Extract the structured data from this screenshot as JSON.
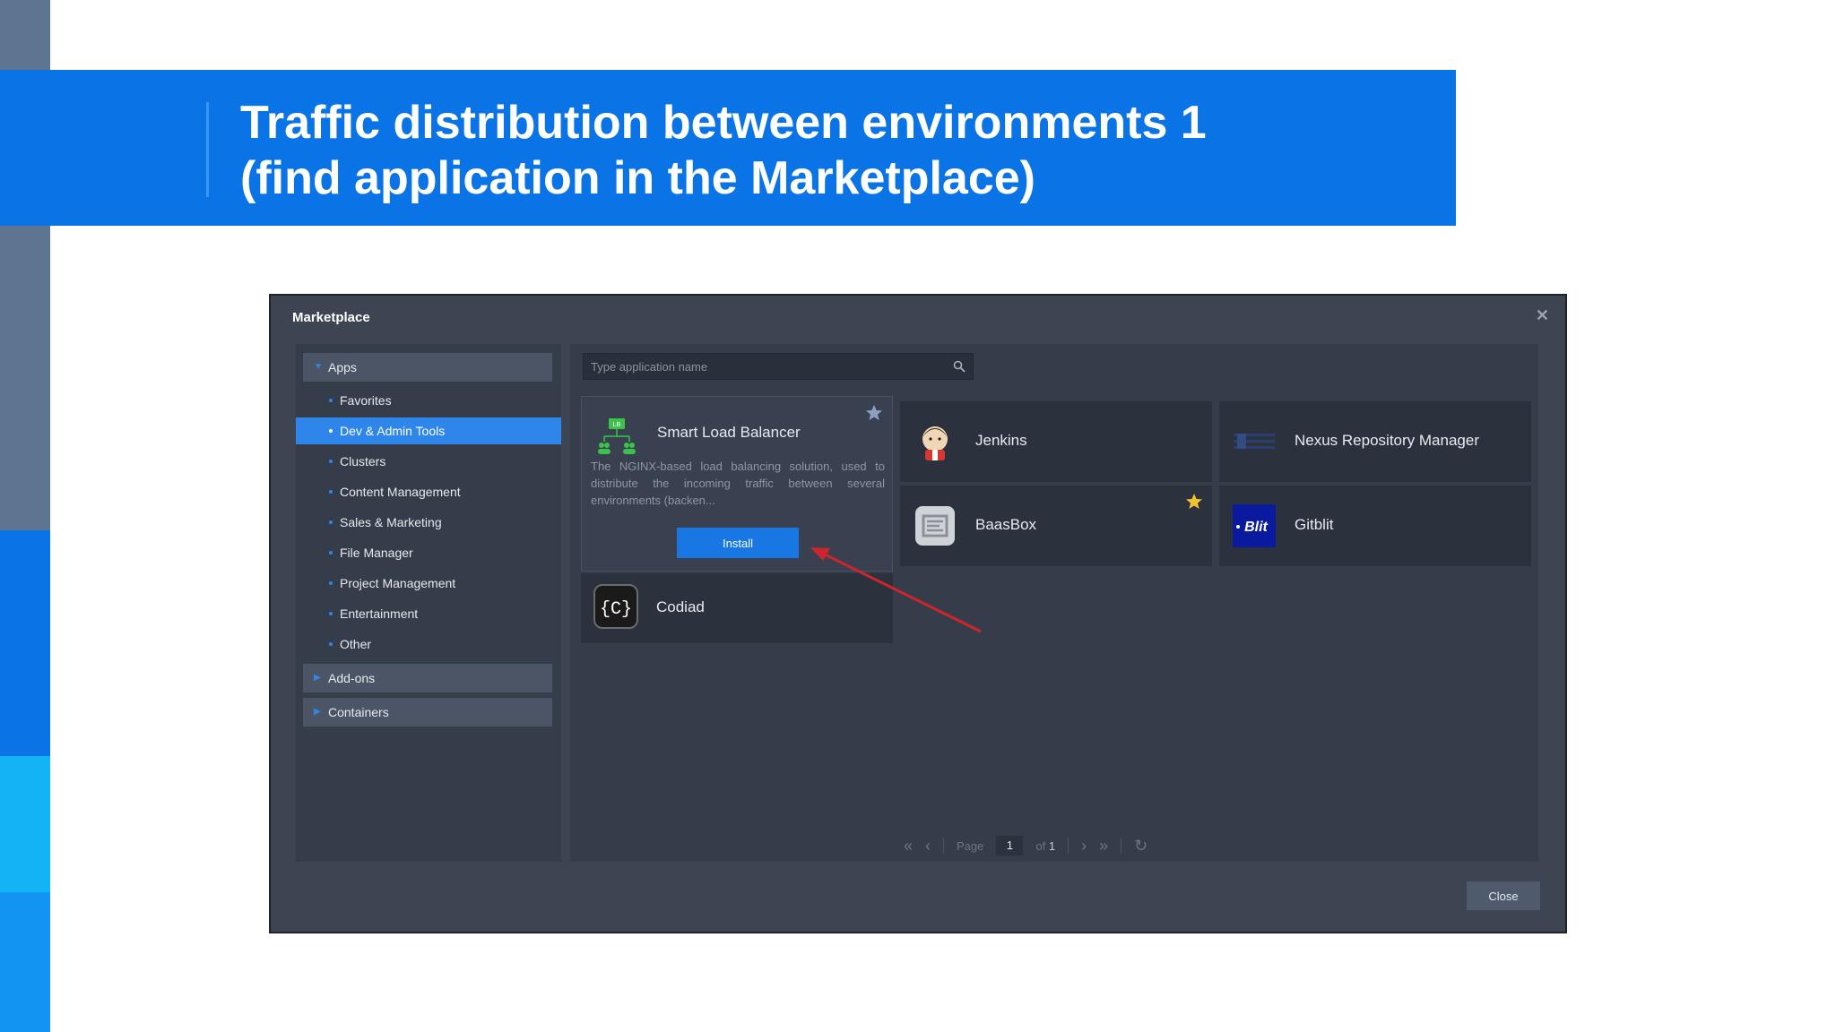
{
  "slide": {
    "title_line1": "Traffic distribution between environments 1",
    "title_line2": "(find application in the Marketplace)"
  },
  "window": {
    "title": "Marketplace",
    "close_x": "✕",
    "close_button": "Close"
  },
  "sidebar": {
    "apps_label": "Apps",
    "items": [
      {
        "label": "Favorites",
        "selected": false
      },
      {
        "label": "Dev & Admin Tools",
        "selected": true
      },
      {
        "label": "Clusters",
        "selected": false
      },
      {
        "label": "Content Management",
        "selected": false
      },
      {
        "label": "Sales & Marketing",
        "selected": false
      },
      {
        "label": "File Manager",
        "selected": false
      },
      {
        "label": "Project Management",
        "selected": false
      },
      {
        "label": "Entertainment",
        "selected": false
      },
      {
        "label": "Other",
        "selected": false
      }
    ],
    "addons_label": "Add-ons",
    "containers_label": "Containers"
  },
  "search": {
    "placeholder": "Type application name",
    "icon": "search-icon"
  },
  "apps": [
    {
      "name": "Smart Load Balancer",
      "description": "The NGINX-based load balancing solution, used to distribute the incoming traffic between several environments (backen...",
      "install_label": "Install",
      "favorite": true,
      "icon": "load-balancer-icon",
      "icon_badge": "LB"
    },
    {
      "name": "Jenkins",
      "icon": "jenkins-icon",
      "favorite": false
    },
    {
      "name": "Nexus Repository Manager",
      "icon": "nexus-icon",
      "favorite": false
    },
    {
      "name": "BaasBox",
      "icon": "baasbox-icon",
      "favorite": true
    },
    {
      "name": "Gitblit",
      "icon": "gitblit-icon",
      "icon_text": "Blit",
      "favorite": false
    },
    {
      "name": "Codiad",
      "icon": "codiad-icon",
      "icon_text": "{C}",
      "favorite": false
    }
  ],
  "pager": {
    "page_label": "Page",
    "page_value": "1",
    "of_label": "of",
    "total": "1"
  },
  "colors": {
    "accent": "#0a74e6",
    "selected": "#2f86ea",
    "install": "#1877e3",
    "arrow": "#d0242c",
    "star_gold": "#f2c12e"
  }
}
